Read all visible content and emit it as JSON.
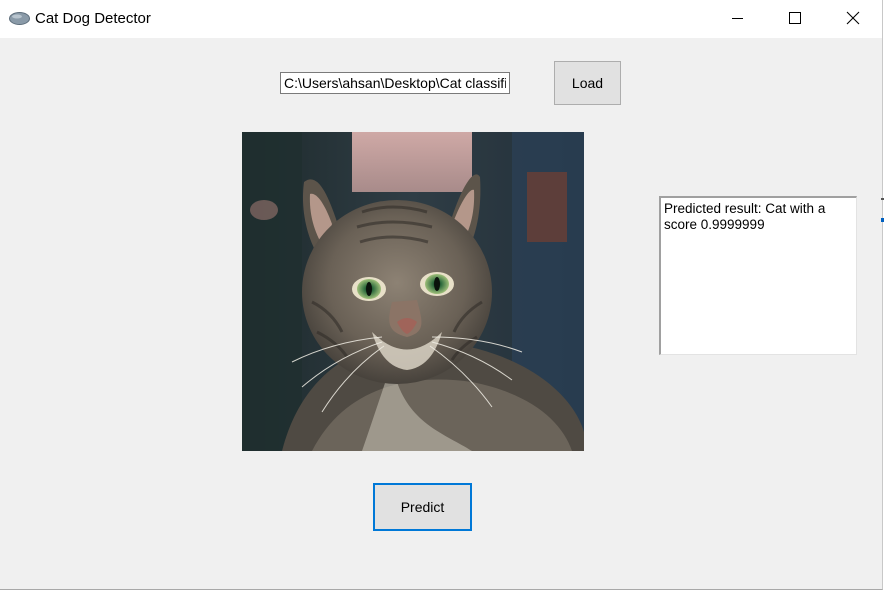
{
  "window": {
    "title": "Cat Dog Detector"
  },
  "file": {
    "path_value": "C:\\Users\\ahsan\\Desktop\\Cat classifier",
    "load_label": "Load"
  },
  "result": {
    "text": "Predicted result: Cat with a score 0.9999999"
  },
  "actions": {
    "predict_label": "Predict"
  },
  "colors": {
    "focus_border": "#0078d7",
    "window_bg": "#f0f0f0",
    "button_bg": "#e1e1e1"
  },
  "icons": {
    "app": "app-icon",
    "minimize": "minimize-icon",
    "maximize": "maximize-icon",
    "close": "close-icon"
  }
}
